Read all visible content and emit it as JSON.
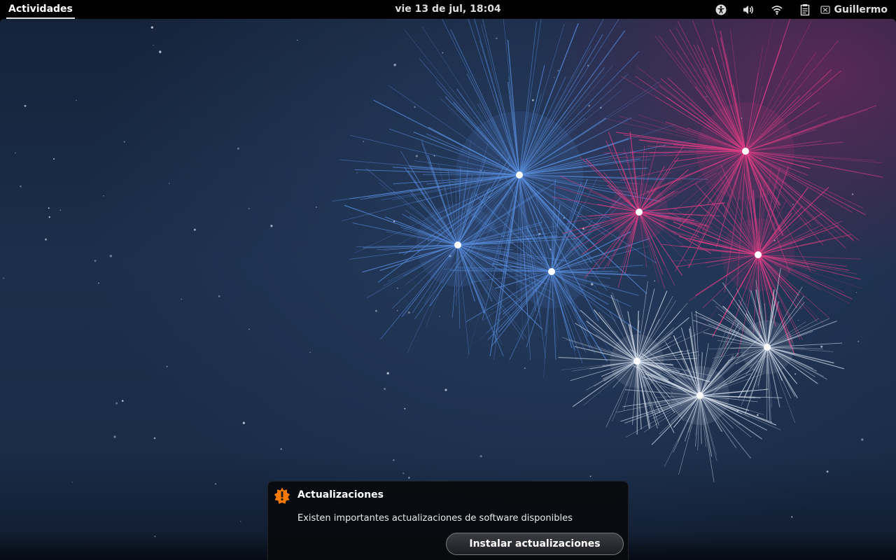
{
  "topbar": {
    "activities_label": "Actividades",
    "clock": "vie 13 de jul, 18:04",
    "user_name": "Guillermo",
    "tray_icons": [
      "accessibility-icon",
      "volume-icon",
      "wifi-icon",
      "clipboard-icon"
    ]
  },
  "notification": {
    "title": "Actualizaciones",
    "body": "Existen importantes actualizaciones de software disponibles",
    "button_label": "Instalar actualizaciones",
    "icon": "update-warning-icon",
    "icon_color": "#f57900"
  },
  "wallpaper": {
    "firework_colors": [
      "#5a8fe0",
      "#e23d86",
      "#d8e2f0"
    ]
  }
}
